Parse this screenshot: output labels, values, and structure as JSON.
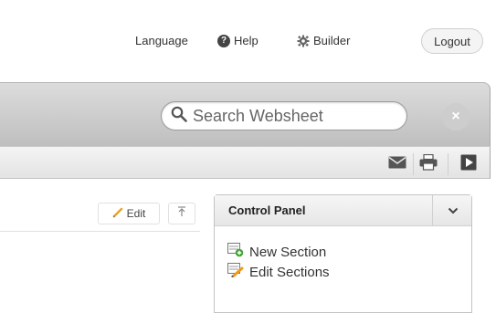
{
  "topnav": {
    "language_label": "Language",
    "help_label": "Help",
    "help_icon_glyph": "?",
    "builder_label": "Builder",
    "logout_label": "Logout"
  },
  "header": {
    "search_placeholder": "Search Websheet",
    "close_glyph": "×"
  },
  "toolbar": {
    "icons": [
      "email-icon",
      "print-icon",
      "present-icon"
    ]
  },
  "content": {
    "edit_label": "Edit"
  },
  "control_panel": {
    "title": "Control Panel",
    "items": [
      {
        "label": "New Section",
        "icon": "new-section-icon"
      },
      {
        "label": "Edit Sections",
        "icon": "edit-sections-icon"
      }
    ]
  },
  "colors": {
    "header_band": "#cfcfcf",
    "toolbar": "#ececec",
    "accent_green": "#3fa535",
    "accent_orange": "#f29a1a"
  }
}
